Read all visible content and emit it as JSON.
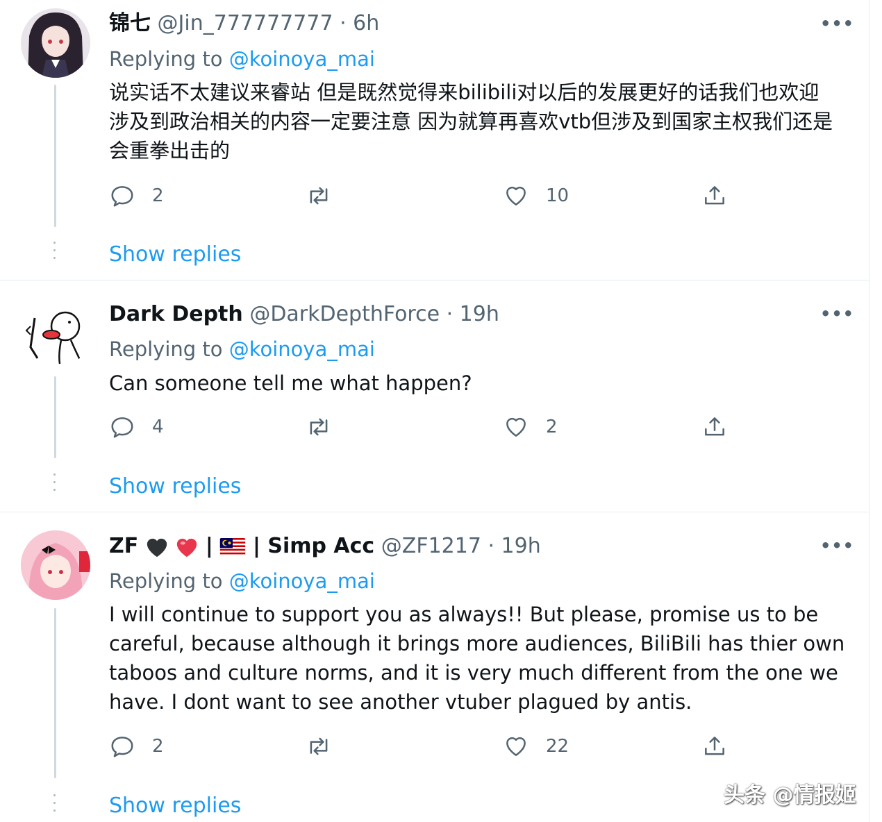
{
  "tweets": [
    {
      "name": "锦七",
      "handle": "@Jin_777777777",
      "time": "· 6h",
      "replying_label": "Replying to",
      "replying_to": "@koinoya_mai",
      "text": "说实话不太建议来睿站 但是既然觉得来bilibili对以后的发展更好的话我们也欢迎 涉及到政治相关的内容一定要注意 因为就算再喜欢vtb但涉及到国家主权我们还是会重拳出击的",
      "replies": "2",
      "likes": "10",
      "show_replies": "Show replies"
    },
    {
      "name": "Dark Depth",
      "handle": "@DarkDepthForce",
      "time": "· 19h",
      "replying_label": "Replying to",
      "replying_to": "@koinoya_mai",
      "text": "Can someone tell me what happen?",
      "replies": "4",
      "likes": "2",
      "show_replies": "Show replies"
    },
    {
      "name": "ZF",
      "name_suffix": "| Simp Acc",
      "handle": "@ZF1217",
      "time": "· 19h",
      "replying_label": "Replying to",
      "replying_to": "@koinoya_mai",
      "text": "I will continue to support you as always!! But please, promise us to be careful, because although it brings more audiences, BiliBili has thier own taboos and culture norms, and it is very much different from the one we have. I dont want to see another vtuber plagued by antis.",
      "replies": "2",
      "likes": "22",
      "show_replies": "Show replies"
    }
  ],
  "more_label": "•••",
  "watermark": "头条 @情报姬",
  "colors": {
    "link": "#1d9bf0",
    "meta": "#536471",
    "text": "#0f1419",
    "divider": "#e6ecf0"
  },
  "icons": [
    "reply-icon",
    "retweet-icon",
    "like-icon",
    "share-icon",
    "more-icon",
    "black-heart-emoji",
    "red-heart-emoji",
    "malaysia-flag-emoji"
  ]
}
